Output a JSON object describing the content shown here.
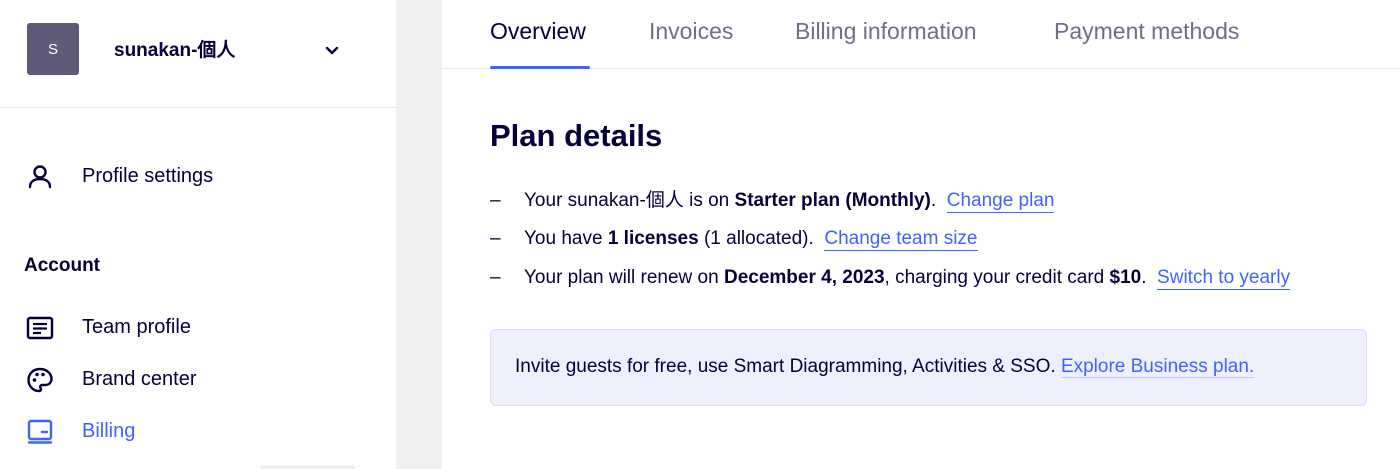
{
  "team": {
    "avatar_initial": "S",
    "name": "sunakan-個人",
    "avatar_color": "#5d5b78"
  },
  "sidebar": {
    "profile_settings": "Profile settings",
    "section_title": "Account",
    "items": [
      {
        "label": "Team profile",
        "icon": "id-card-icon"
      },
      {
        "label": "Brand center",
        "icon": "palette-icon"
      },
      {
        "label": "Billing",
        "icon": "billing-icon",
        "active": true
      }
    ]
  },
  "tabs": [
    {
      "label": "Overview",
      "active": true
    },
    {
      "label": "Invoices"
    },
    {
      "label": "Billing information"
    },
    {
      "label": "Payment methods"
    }
  ],
  "plan": {
    "title": "Plan details",
    "line1": {
      "prefix": "Your sunakan-個人 is on ",
      "bold": "Starter plan (Monthly)",
      "suffix": ".",
      "link": "Change plan"
    },
    "line2": {
      "prefix": "You have ",
      "bold": "1 licenses",
      "suffix": " (1 allocated).",
      "link": "Change team size"
    },
    "line3": {
      "prefix": "Your plan will renew on ",
      "bold_date": "December 4, 2023",
      "middle": ", charging your credit card ",
      "bold_amount": "$10",
      "suffix": ".",
      "link": "Switch to yearly"
    }
  },
  "promo": {
    "text": "Invite guests for free, use Smart Diagramming, Activities & SSO. ",
    "link": "Explore Business plan."
  },
  "colors": {
    "accent": "#4262ff",
    "text": "#050038",
    "muted": "#6f6d87",
    "promo_bg": "#eef0fd"
  }
}
